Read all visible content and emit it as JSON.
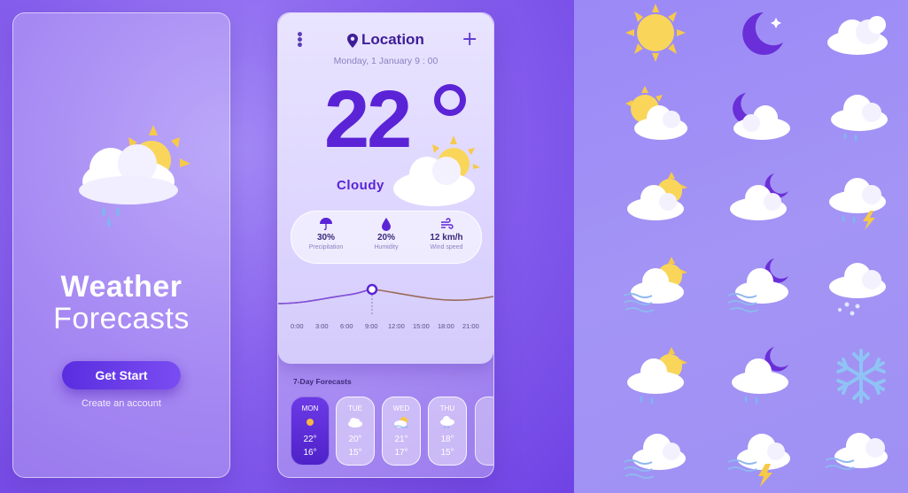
{
  "splash": {
    "title_line1": "Weather",
    "title_line2": "Forecasts",
    "get_start_label": "Get Start",
    "create_account_label": "Create an account"
  },
  "header": {
    "location": "Location",
    "date": "Monday, 1 January 9 : 00"
  },
  "current": {
    "temperature": "22",
    "condition": "Cloudy"
  },
  "stats": [
    {
      "value": "30%",
      "label": "Precipitation",
      "icon": "umbrella-icon"
    },
    {
      "value": "20%",
      "label": "Humidity",
      "icon": "droplet-icon"
    },
    {
      "value": "12 km/h",
      "label": "Wind speed",
      "icon": "wind-icon"
    }
  ],
  "hourly": {
    "times": [
      "0:00",
      "3:00",
      "6:00",
      "9:00",
      "12:00",
      "15:00",
      "18:00",
      "21:00"
    ],
    "selected": "9:00"
  },
  "forecast": {
    "title": "7-Day Forecasts",
    "days": [
      {
        "day": "MON",
        "high": "22°",
        "low": "16°",
        "icon": "sun-icon"
      },
      {
        "day": "TUE",
        "high": "20°",
        "low": "15°",
        "icon": "cloud-icon"
      },
      {
        "day": "WED",
        "high": "21°",
        "low": "17°",
        "icon": "sun-cloud-wind-icon"
      },
      {
        "day": "THU",
        "high": "18°",
        "low": "15°",
        "icon": "cloud-snow-icon"
      }
    ]
  },
  "colors": {
    "accent": "#5b23d6",
    "sun": "#f7c948",
    "cloud": "#ffffff",
    "rain": "#7fb6f0",
    "moon": "#6a2fd8"
  },
  "icon_set": [
    "sun-icon",
    "moon-stars-icon",
    "cloud-icon",
    "sun-cloud-icon",
    "moon-cloud-icon",
    "cloud-rain-icon",
    "sun-behind-cloud-icon",
    "moon-behind-cloud-icon",
    "cloud-rain-lightning-icon",
    "sun-cloud-wind-icon",
    "moon-cloud-wind-icon",
    "cloud-hail-icon",
    "sun-cloud-rain-icon",
    "moon-cloud-rain-icon",
    "snowflake-icon",
    "cloud-wind-icon",
    "cloud-wind-lightning-icon",
    "cloud-fog-icon"
  ]
}
